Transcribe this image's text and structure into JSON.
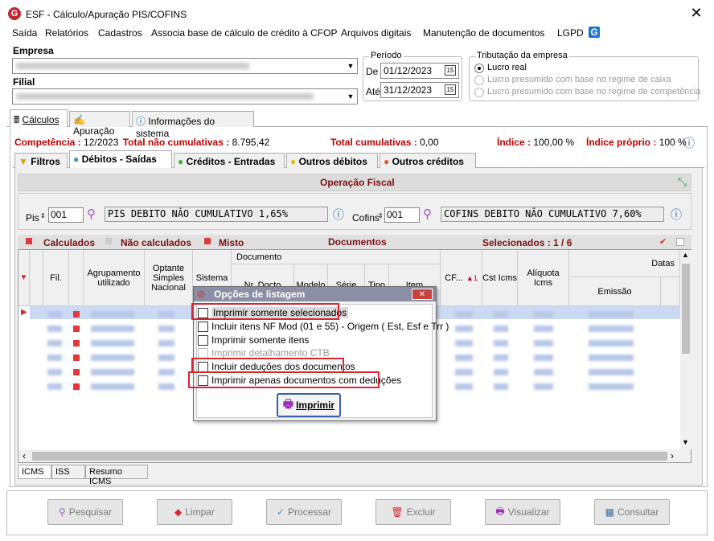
{
  "window": {
    "title": "ESF - Cálculo/Apuração PIS/COFINS",
    "logo": "G"
  },
  "menu": [
    "Saída",
    "Relatórios",
    "Cadastros",
    "Associa base de cálculo de crédito à CFOP",
    "Arquivos digitais",
    "Manutenção de documentos",
    "LGPD"
  ],
  "empresa": {
    "label": "Empresa"
  },
  "filial": {
    "label": "Filial"
  },
  "periodo": {
    "label": "Período",
    "de_label": "De",
    "de": "01/12/2023",
    "ate_label": "Até",
    "ate": "31/12/2023"
  },
  "tributacao": {
    "label": "Tributação da empresa",
    "options": [
      "Lucro real",
      "Lucro presumido com base no regime de caixa",
      "Lucro presumido com base no regime de competência"
    ]
  },
  "main_tabs": [
    "Cálculos",
    "Apuração",
    "Informações do sistema"
  ],
  "summary": {
    "competencia_label": "Competência :",
    "competencia": "12/2023",
    "total_nao_cumul_label": "Total não cumulativas :",
    "total_nao_cumul": "8.795,42",
    "total_cumul_label": "Total cumulativas :",
    "total_cumul": "0,00",
    "indice_label": "Índice :",
    "indice": "100,00 %",
    "indice_proprio_label": "Índice próprio :",
    "indice_proprio": "100 %"
  },
  "sub_tabs": [
    "Filtros",
    "Débitos - Saídas",
    "Créditos - Entradas",
    "Outros débitos",
    "Outros créditos"
  ],
  "operacao": {
    "title": "Operação Fiscal",
    "pis_label": "Pis",
    "pis_code": "001",
    "pis_desc": "PIS DEBITO  NÃO CUMULATIVO 1,65%",
    "cofins_label": "Cofins",
    "cofins_code": "001",
    "cofins_desc": "COFINS DEBITO NÃO CUMULATIVO 7,60%"
  },
  "legend": {
    "calculados": "Calculados",
    "nao_calculados": "Não calculados",
    "misto": "Misto",
    "documentos": "Documentos",
    "selecionados": "Selecionados : 1 / 6"
  },
  "grid_headers": {
    "fil": "Fil.",
    "agrupamento": "Agrupamento utilizado",
    "optante": "Optante Simples Nacional",
    "sistema": "Sistema",
    "documento": "Documento",
    "nr": "Nr. Docto",
    "modelo": "Modelo",
    "serie": "Série",
    "tipo": "Tipo",
    "item": "Item",
    "cfop": "CF...",
    "cst": "Cst Icms",
    "aliquota": "Alíquota Icms",
    "datas": "Datas",
    "emissao": "Emissão"
  },
  "dialog": {
    "title": "Opções de listagem",
    "options": [
      "Imprimir somente selecionados",
      "Incluir itens NF Mod (01 e 55) - Origem ( Est, Esf e Trr )",
      "Imprimir somente itens",
      "Imprimir detalhamento CTB",
      "Incluir deduções dos documentos",
      "Imprimir apenas documentos com deduções"
    ],
    "print_button": "Imprimir"
  },
  "bottom_tabs": [
    "ICMS",
    "ISS",
    "Resumo ICMS"
  ],
  "buttons": [
    "Pesquisar",
    "Limpar",
    "Processar",
    "Excluir",
    "Visualizar",
    "Consultar"
  ]
}
